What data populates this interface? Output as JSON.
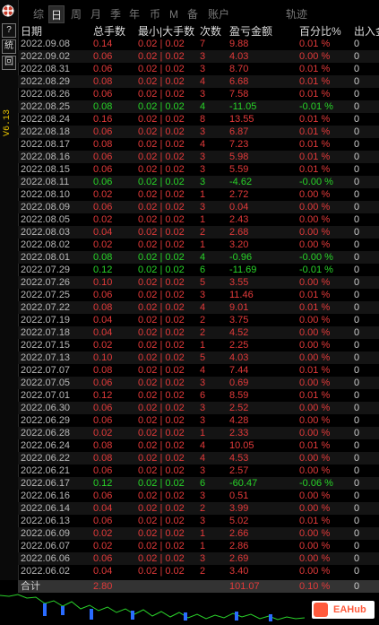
{
  "toolbar": {
    "version": "V6.13",
    "help_label": "?",
    "stats_label": "統",
    "restore_label": "回"
  },
  "tabs": [
    {
      "label": "综",
      "active": false
    },
    {
      "label": "日",
      "active": true
    },
    {
      "label": "周",
      "active": false
    },
    {
      "label": "月",
      "active": false
    },
    {
      "label": "季",
      "active": false
    },
    {
      "label": "年",
      "active": false
    },
    {
      "label": "币",
      "active": false
    },
    {
      "label": "M",
      "active": false
    },
    {
      "label": "备",
      "active": false
    },
    {
      "label": "账户",
      "active": false
    },
    {
      "label": "轨迹",
      "active": false
    }
  ],
  "table": {
    "headers": [
      "日期",
      "总手数",
      "最小|大手数",
      "次数",
      "盈亏金额",
      "百分比%",
      "出入金"
    ],
    "rows": [
      {
        "date": "2022.09.08",
        "total": "0.14",
        "minmax": "0.02 | 0.02",
        "count": "7",
        "pl": "9.88",
        "pct": "0.01 %",
        "io": "0",
        "sign": "pos"
      },
      {
        "date": "2022.09.02",
        "total": "0.06",
        "minmax": "0.02 | 0.02",
        "count": "3",
        "pl": "4.03",
        "pct": "0.00 %",
        "io": "0",
        "sign": "pos"
      },
      {
        "date": "2022.08.31",
        "total": "0.06",
        "minmax": "0.02 | 0.02",
        "count": "3",
        "pl": "8.70",
        "pct": "0.01 %",
        "io": "0",
        "sign": "pos"
      },
      {
        "date": "2022.08.29",
        "total": "0.08",
        "minmax": "0.02 | 0.02",
        "count": "4",
        "pl": "6.68",
        "pct": "0.01 %",
        "io": "0",
        "sign": "pos"
      },
      {
        "date": "2022.08.26",
        "total": "0.06",
        "minmax": "0.02 | 0.02",
        "count": "3",
        "pl": "7.58",
        "pct": "0.01 %",
        "io": "0",
        "sign": "pos"
      },
      {
        "date": "2022.08.25",
        "total": "0.08",
        "minmax": "0.02 | 0.02",
        "count": "4",
        "pl": "-11.05",
        "pct": "-0.01 %",
        "io": "0",
        "sign": "neg"
      },
      {
        "date": "2022.08.24",
        "total": "0.16",
        "minmax": "0.02 | 0.02",
        "count": "8",
        "pl": "13.55",
        "pct": "0.01 %",
        "io": "0",
        "sign": "pos"
      },
      {
        "date": "2022.08.18",
        "total": "0.06",
        "minmax": "0.02 | 0.02",
        "count": "3",
        "pl": "6.87",
        "pct": "0.01 %",
        "io": "0",
        "sign": "pos"
      },
      {
        "date": "2022.08.17",
        "total": "0.08",
        "minmax": "0.02 | 0.02",
        "count": "4",
        "pl": "7.23",
        "pct": "0.01 %",
        "io": "0",
        "sign": "pos"
      },
      {
        "date": "2022.08.16",
        "total": "0.06",
        "minmax": "0.02 | 0.02",
        "count": "3",
        "pl": "5.98",
        "pct": "0.01 %",
        "io": "0",
        "sign": "pos"
      },
      {
        "date": "2022.08.15",
        "total": "0.06",
        "minmax": "0.02 | 0.02",
        "count": "3",
        "pl": "5.59",
        "pct": "0.01 %",
        "io": "0",
        "sign": "pos"
      },
      {
        "date": "2022.08.11",
        "total": "0.06",
        "minmax": "0.02 | 0.02",
        "count": "3",
        "pl": "-4.62",
        "pct": "-0.00 %",
        "io": "0",
        "sign": "neg"
      },
      {
        "date": "2022.08.10",
        "total": "0.02",
        "minmax": "0.02 | 0.02",
        "count": "1",
        "pl": "2.72",
        "pct": "0.00 %",
        "io": "0",
        "sign": "pos"
      },
      {
        "date": "2022.08.09",
        "total": "0.06",
        "minmax": "0.02 | 0.02",
        "count": "3",
        "pl": "0.04",
        "pct": "0.00 %",
        "io": "0",
        "sign": "pos"
      },
      {
        "date": "2022.08.05",
        "total": "0.02",
        "minmax": "0.02 | 0.02",
        "count": "1",
        "pl": "2.43",
        "pct": "0.00 %",
        "io": "0",
        "sign": "pos"
      },
      {
        "date": "2022.08.03",
        "total": "0.04",
        "minmax": "0.02 | 0.02",
        "count": "2",
        "pl": "2.68",
        "pct": "0.00 %",
        "io": "0",
        "sign": "pos"
      },
      {
        "date": "2022.08.02",
        "total": "0.02",
        "minmax": "0.02 | 0.02",
        "count": "1",
        "pl": "3.20",
        "pct": "0.00 %",
        "io": "0",
        "sign": "pos"
      },
      {
        "date": "2022.08.01",
        "total": "0.08",
        "minmax": "0.02 | 0.02",
        "count": "4",
        "pl": "-0.96",
        "pct": "-0.00 %",
        "io": "0",
        "sign": "neg"
      },
      {
        "date": "2022.07.29",
        "total": "0.12",
        "minmax": "0.02 | 0.02",
        "count": "6",
        "pl": "-11.69",
        "pct": "-0.01 %",
        "io": "0",
        "sign": "neg"
      },
      {
        "date": "2022.07.26",
        "total": "0.10",
        "minmax": "0.02 | 0.02",
        "count": "5",
        "pl": "3.55",
        "pct": "0.00 %",
        "io": "0",
        "sign": "pos"
      },
      {
        "date": "2022.07.25",
        "total": "0.06",
        "minmax": "0.02 | 0.02",
        "count": "3",
        "pl": "11.46",
        "pct": "0.01 %",
        "io": "0",
        "sign": "pos"
      },
      {
        "date": "2022.07.22",
        "total": "0.08",
        "minmax": "0.02 | 0.02",
        "count": "4",
        "pl": "9.01",
        "pct": "0.01 %",
        "io": "0",
        "sign": "pos"
      },
      {
        "date": "2022.07.19",
        "total": "0.04",
        "minmax": "0.02 | 0.02",
        "count": "2",
        "pl": "3.75",
        "pct": "0.00 %",
        "io": "0",
        "sign": "pos"
      },
      {
        "date": "2022.07.18",
        "total": "0.04",
        "minmax": "0.02 | 0.02",
        "count": "2",
        "pl": "4.52",
        "pct": "0.00 %",
        "io": "0",
        "sign": "pos"
      },
      {
        "date": "2022.07.15",
        "total": "0.02",
        "minmax": "0.02 | 0.02",
        "count": "1",
        "pl": "2.25",
        "pct": "0.00 %",
        "io": "0",
        "sign": "pos"
      },
      {
        "date": "2022.07.13",
        "total": "0.10",
        "minmax": "0.02 | 0.02",
        "count": "5",
        "pl": "4.03",
        "pct": "0.00 %",
        "io": "0",
        "sign": "pos"
      },
      {
        "date": "2022.07.07",
        "total": "0.08",
        "minmax": "0.02 | 0.02",
        "count": "4",
        "pl": "7.44",
        "pct": "0.01 %",
        "io": "0",
        "sign": "pos"
      },
      {
        "date": "2022.07.05",
        "total": "0.06",
        "minmax": "0.02 | 0.02",
        "count": "3",
        "pl": "0.69",
        "pct": "0.00 %",
        "io": "0",
        "sign": "pos"
      },
      {
        "date": "2022.07.01",
        "total": "0.12",
        "minmax": "0.02 | 0.02",
        "count": "6",
        "pl": "8.59",
        "pct": "0.01 %",
        "io": "0",
        "sign": "pos"
      },
      {
        "date": "2022.06.30",
        "total": "0.06",
        "minmax": "0.02 | 0.02",
        "count": "3",
        "pl": "2.52",
        "pct": "0.00 %",
        "io": "0",
        "sign": "pos"
      },
      {
        "date": "2022.06.29",
        "total": "0.06",
        "minmax": "0.02 | 0.02",
        "count": "3",
        "pl": "4.28",
        "pct": "0.00 %",
        "io": "0",
        "sign": "pos"
      },
      {
        "date": "2022.06.28",
        "total": "0.02",
        "minmax": "0.02 | 0.02",
        "count": "1",
        "pl": "2.33",
        "pct": "0.00 %",
        "io": "0",
        "sign": "pos"
      },
      {
        "date": "2022.06.24",
        "total": "0.08",
        "minmax": "0.02 | 0.02",
        "count": "4",
        "pl": "10.05",
        "pct": "0.01 %",
        "io": "0",
        "sign": "pos"
      },
      {
        "date": "2022.06.22",
        "total": "0.08",
        "minmax": "0.02 | 0.02",
        "count": "4",
        "pl": "4.53",
        "pct": "0.00 %",
        "io": "0",
        "sign": "pos"
      },
      {
        "date": "2022.06.21",
        "total": "0.06",
        "minmax": "0.02 | 0.02",
        "count": "3",
        "pl": "2.57",
        "pct": "0.00 %",
        "io": "0",
        "sign": "pos"
      },
      {
        "date": "2022.06.17",
        "total": "0.12",
        "minmax": "0.02 | 0.02",
        "count": "6",
        "pl": "-60.47",
        "pct": "-0.06 %",
        "io": "0",
        "sign": "neg"
      },
      {
        "date": "2022.06.16",
        "total": "0.06",
        "minmax": "0.02 | 0.02",
        "count": "3",
        "pl": "0.51",
        "pct": "0.00 %",
        "io": "0",
        "sign": "pos"
      },
      {
        "date": "2022.06.14",
        "total": "0.04",
        "minmax": "0.02 | 0.02",
        "count": "2",
        "pl": "3.99",
        "pct": "0.00 %",
        "io": "0",
        "sign": "pos"
      },
      {
        "date": "2022.06.13",
        "total": "0.06",
        "minmax": "0.02 | 0.02",
        "count": "3",
        "pl": "5.02",
        "pct": "0.01 %",
        "io": "0",
        "sign": "pos"
      },
      {
        "date": "2022.06.09",
        "total": "0.02",
        "minmax": "0.02 | 0.02",
        "count": "1",
        "pl": "2.66",
        "pct": "0.00 %",
        "io": "0",
        "sign": "pos"
      },
      {
        "date": "2022.06.07",
        "total": "0.02",
        "minmax": "0.02 | 0.02",
        "count": "1",
        "pl": "2.86",
        "pct": "0.00 %",
        "io": "0",
        "sign": "pos"
      },
      {
        "date": "2022.06.06",
        "total": "0.06",
        "minmax": "0.02 | 0.02",
        "count": "3",
        "pl": "2.69",
        "pct": "0.00 %",
        "io": "0",
        "sign": "pos"
      },
      {
        "date": "2022.06.02",
        "total": "0.04",
        "minmax": "0.02 | 0.02",
        "count": "2",
        "pl": "3.40",
        "pct": "0.00 %",
        "io": "0",
        "sign": "pos"
      }
    ],
    "total": {
      "label": "合计",
      "total": "2.80",
      "pl": "101.07",
      "pct": "0.10 %",
      "io": "0"
    }
  },
  "colors": {
    "positive": "#e23a3a",
    "negative": "#28d428",
    "background": "#000000"
  },
  "watermark": "EAHub"
}
